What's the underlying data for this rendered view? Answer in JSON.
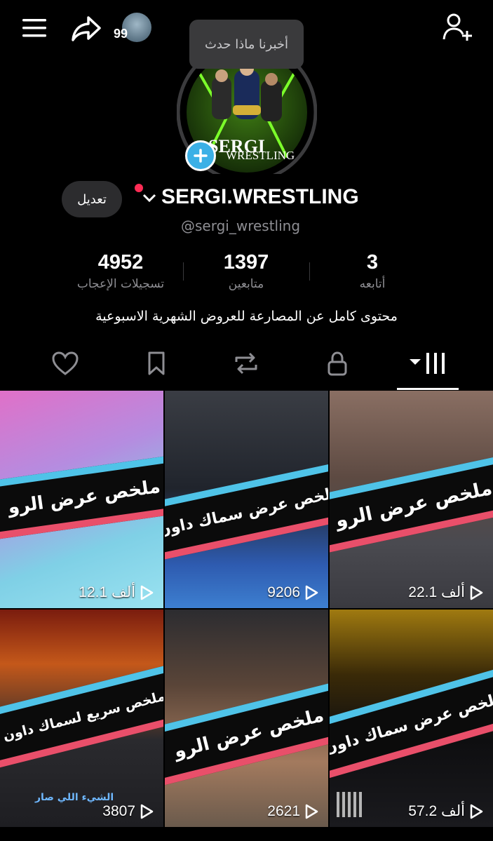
{
  "header": {
    "menu_icon": "hamburger-menu-icon",
    "share_icon": "share-arrow-icon",
    "notification_count": "99",
    "add_friend_icon": "person-plus-icon"
  },
  "profile": {
    "status_bubble": "أخبرنا ماذا حدث",
    "logo_text_line1": "SERGI",
    "logo_text_line2": "WRESTLING",
    "edit_label": "تعديل",
    "display_name": "SERGI.WRESTLING",
    "username": "@sergi_wrestling",
    "bio": "محتوى كامل عن المصارعة للعروض الشهرية الاسبوعية"
  },
  "stats": [
    {
      "value": "4952",
      "label": "تسجيلات الإعجاب"
    },
    {
      "value": "1397",
      "label": "متابعين"
    },
    {
      "value": "3",
      "label": "أتابعه"
    }
  ],
  "tabs": {
    "liked_icon": "heart-icon",
    "saved_icon": "bookmark-icon",
    "reposts_icon": "repost-icon",
    "private_icon": "lock-icon",
    "videos_icon": "grid-icon"
  },
  "videos": [
    {
      "title": "ملخص عرض الرو",
      "views": "12.1 ألف"
    },
    {
      "title": "ملخص عرض سماك داون",
      "views": "9206"
    },
    {
      "title": "ملخص عرض الرو",
      "views": "22.1 ألف"
    },
    {
      "title": "ملخص سريع لسماك داون",
      "views": "3807",
      "caption": "الشيء اللي صار"
    },
    {
      "title": "ملخص عرض الرو",
      "views": "2621"
    },
    {
      "title": "ملخص عرض سماك داون",
      "views": "57.2 ألف"
    }
  ],
  "colors": {
    "accent_blue": "#4fc3e8",
    "accent_red": "#e94f6a",
    "notify_dot": "#fe2c55"
  }
}
